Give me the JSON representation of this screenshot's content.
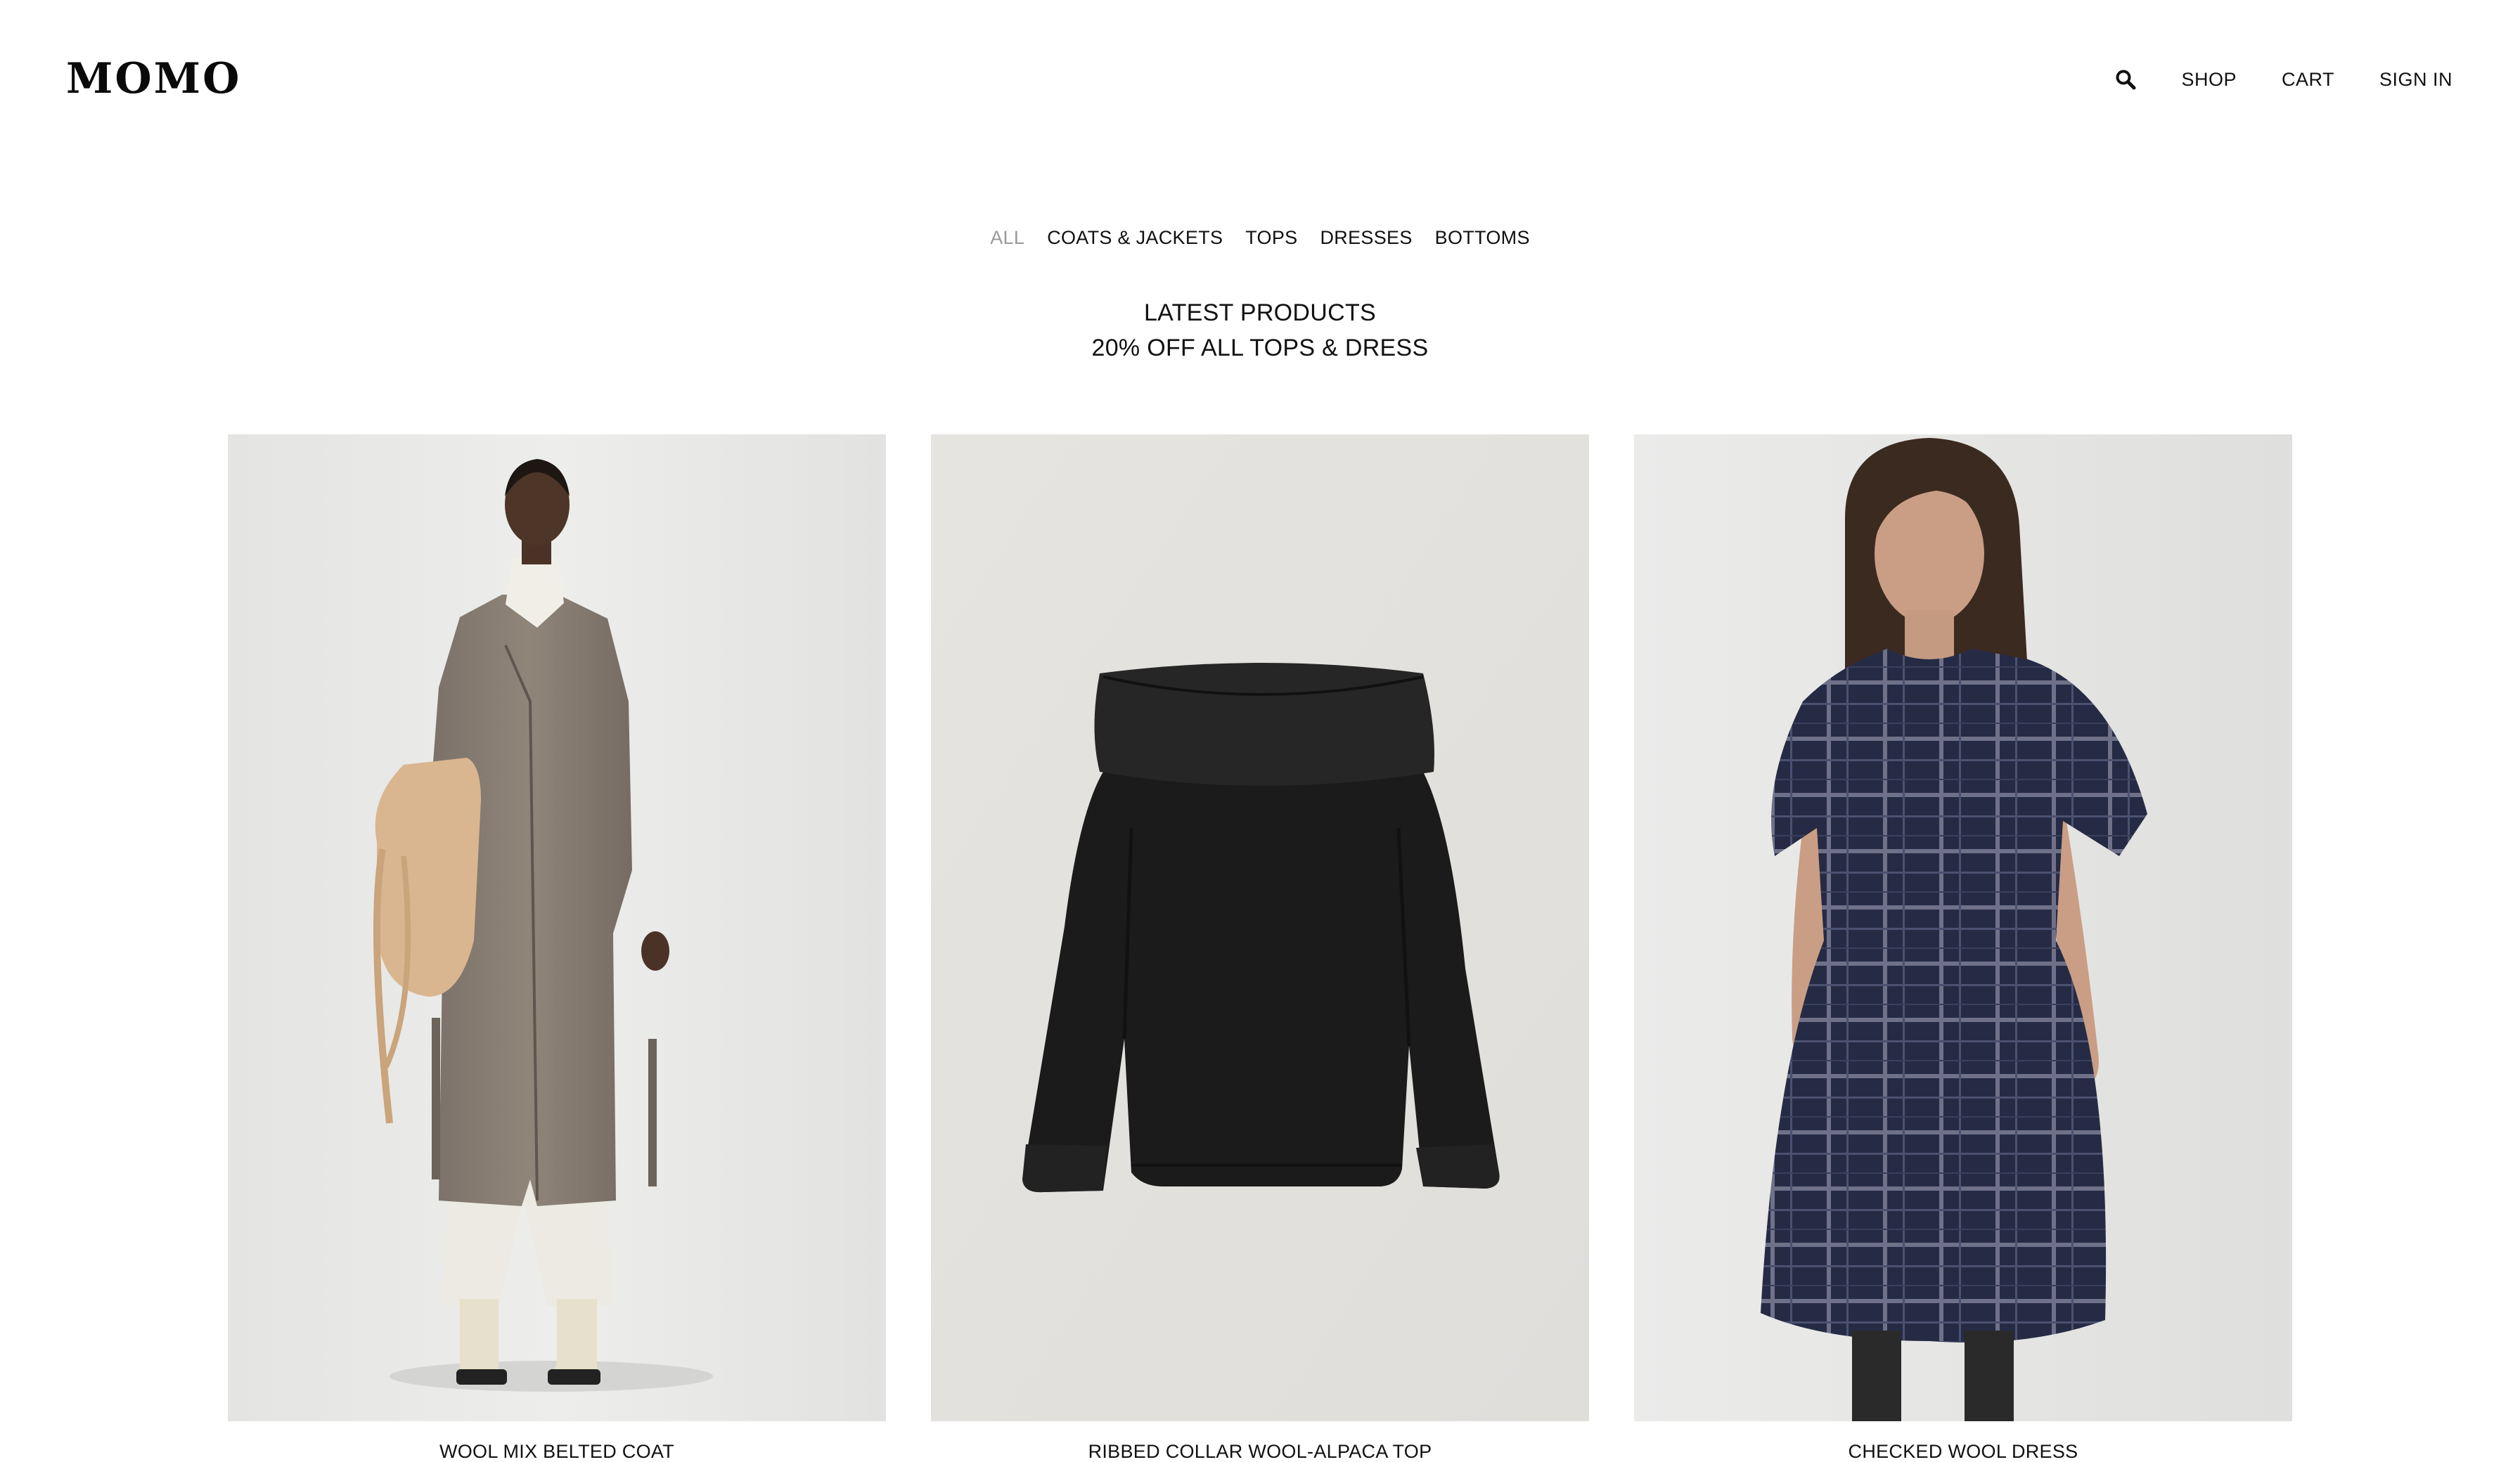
{
  "brand": {
    "logo_text": "MOMO"
  },
  "header": {
    "search_icon": "search-icon",
    "nav": [
      {
        "label": "SHOP"
      },
      {
        "label": "CART"
      },
      {
        "label": "SIGN IN"
      }
    ]
  },
  "categories": {
    "active": "ALL",
    "items": [
      {
        "label": "ALL"
      },
      {
        "label": "COATS & JACKETS"
      },
      {
        "label": "TOPS"
      },
      {
        "label": "DRESSES"
      },
      {
        "label": "BOTTOMS"
      }
    ]
  },
  "headline": {
    "title": "LATEST PRODUCTS",
    "subtitle": "20% OFF ALL TOPS & DRESS"
  },
  "products": [
    {
      "name": "WOOL MIX BELTED COAT",
      "image": "model-in-long-grey-coat-with-beige-bag"
    },
    {
      "name": "RIBBED COLLAR WOOL-ALPACA TOP",
      "image": "black-off-shoulder-knit-top"
    },
    {
      "name": "CHECKED WOOL DRESS",
      "image": "model-in-navy-plaid-dress"
    }
  ],
  "colors": {
    "text": "#111111",
    "active_category": "#9a9a9a",
    "background": "#ffffff"
  }
}
